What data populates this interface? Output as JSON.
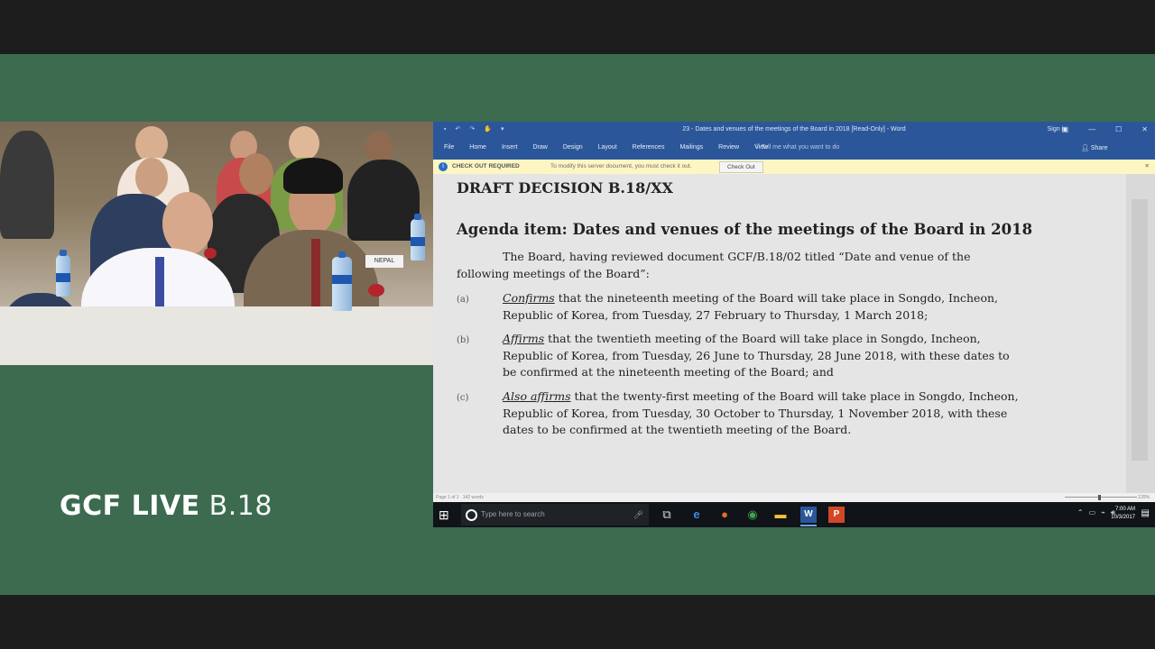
{
  "branding": {
    "main": "GCF LIVE",
    "sub": "B.18"
  },
  "word": {
    "title": "23 - Dates and venues of the meetings of the Board in 2018 [Read-Only] - Word",
    "signin": "Sign in",
    "ribbon_tabs": [
      "File",
      "Home",
      "Insert",
      "Draw",
      "Design",
      "Layout",
      "References",
      "Mailings",
      "Review",
      "View"
    ],
    "tell_me": "Tell me what you want to do",
    "share": "Share",
    "message_bar": {
      "label": "CHECK OUT REQUIRED",
      "text": "To modify this server document, you must check it out.",
      "button": "Check Out"
    },
    "statusbar": {
      "page": "Page 1 of 1",
      "words": "142 words",
      "zoom": "120%"
    }
  },
  "document": {
    "heading": "DRAFT DECISION B.18/XX",
    "agenda": "Agenda item:  Dates and venues of the meetings of the Board in 2018",
    "intro_line1": "The Board, having reviewed document GCF/B.18/02 titled “Date and venue of the",
    "intro_line2": "following  meetings of the Board”:",
    "items": [
      {
        "label": "(a)",
        "verb": "Confirms",
        "rest_line1": " that the nineteenth meeting of the Board will take place in Songdo, Incheon,",
        "line2": "Republic of Korea, from Tuesday, 27 February to Thursday, 1 March 2018;",
        "line3": ""
      },
      {
        "label": "(b)",
        "verb": "Affirms",
        "rest_line1": " that the twentieth meeting of the Board will take place in Songdo, Incheon,",
        "line2": "Republic of Korea, from Tuesday, 26 June to Thursday, 28 June 2018, with these dates to",
        "line3": "be confirmed at the nineteenth meeting of the Board; and"
      },
      {
        "label": "(c)",
        "verb": "Also affirms",
        "rest_line1": " that the twenty-first meeting of the Board will take place in Songdo, Incheon,",
        "line2": "Republic of Korea, from Tuesday, 30 October to Thursday, 1 November 2018, with these",
        "line3": "dates to be confirmed at the twentieth meeting of the Board."
      }
    ]
  },
  "taskbar": {
    "search_placeholder": "Type here to search",
    "time": "7:00 AM",
    "date": "10/3/2017",
    "icons": [
      "windows-start-icon",
      "search-icon",
      "microphone-icon",
      "task-view-icon",
      "edge-icon",
      "firefox-icon",
      "chrome-icon",
      "file-explorer-icon",
      "word-icon",
      "powerpoint-icon"
    ]
  },
  "colors": {
    "broadcast_green": "#3c6b50",
    "word_blue": "#2b579a",
    "message_bar": "#fdf6c3",
    "taskbar": "#101418"
  }
}
